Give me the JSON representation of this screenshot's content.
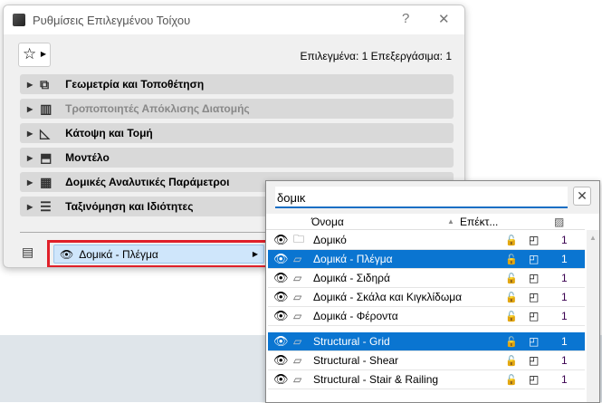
{
  "dialog": {
    "title": "Ρυθμίσεις Επιλεγμένου Τοίχου",
    "help": "?",
    "close": "✕",
    "selection_info": "Επιλεγμένα: 1 Επεξεργάσιμα: 1",
    "panels": [
      {
        "label": "Γεωμετρία και Τοποθέτηση",
        "icon": "geometry-icon",
        "disabled": false
      },
      {
        "label": "Τροποποιητές Απόκλισης Διατομής",
        "icon": "profile-icon",
        "disabled": true
      },
      {
        "label": "Κάτοψη και Τομή",
        "icon": "floorplan-icon",
        "disabled": false
      },
      {
        "label": "Μοντέλο",
        "icon": "model-icon",
        "disabled": false
      },
      {
        "label": "Δομικές Αναλυτικές Παράμετροι",
        "icon": "structural-icon",
        "disabled": false
      },
      {
        "label": "Ταξινόμηση και Ιδιότητες",
        "icon": "properties-icon",
        "disabled": false
      }
    ],
    "layer_value": "Δομικά - Πλέγμα"
  },
  "popup": {
    "search_value": "δομικ",
    "columns": {
      "name": "Όνομα",
      "ext": "Επέκτ..."
    },
    "rows": [
      {
        "name": "Δομικό",
        "type": "folder",
        "num": "1",
        "selected": false
      },
      {
        "name": "Δομικά - Πλέγμα",
        "type": "layer",
        "num": "1",
        "selected": true
      },
      {
        "name": "Δομικά - Σιδηρά",
        "type": "layer",
        "num": "1",
        "selected": false
      },
      {
        "name": "Δομικά - Σκάλα και Κιγκλίδωμα",
        "type": "layer",
        "num": "1",
        "selected": false
      },
      {
        "name": "Δομικά - Φέροντα",
        "type": "layer",
        "num": "1",
        "selected": false
      },
      {
        "name": "Structural - Grid",
        "type": "layer",
        "num": "1",
        "selected": true
      },
      {
        "name": "Structural - Shear",
        "type": "layer",
        "num": "1",
        "selected": false
      },
      {
        "name": "Structural - Stair & Railing",
        "type": "layer",
        "num": "1",
        "selected": false
      }
    ]
  },
  "colors": {
    "selection": "#0a75d1",
    "highlight": "#e0202a"
  }
}
